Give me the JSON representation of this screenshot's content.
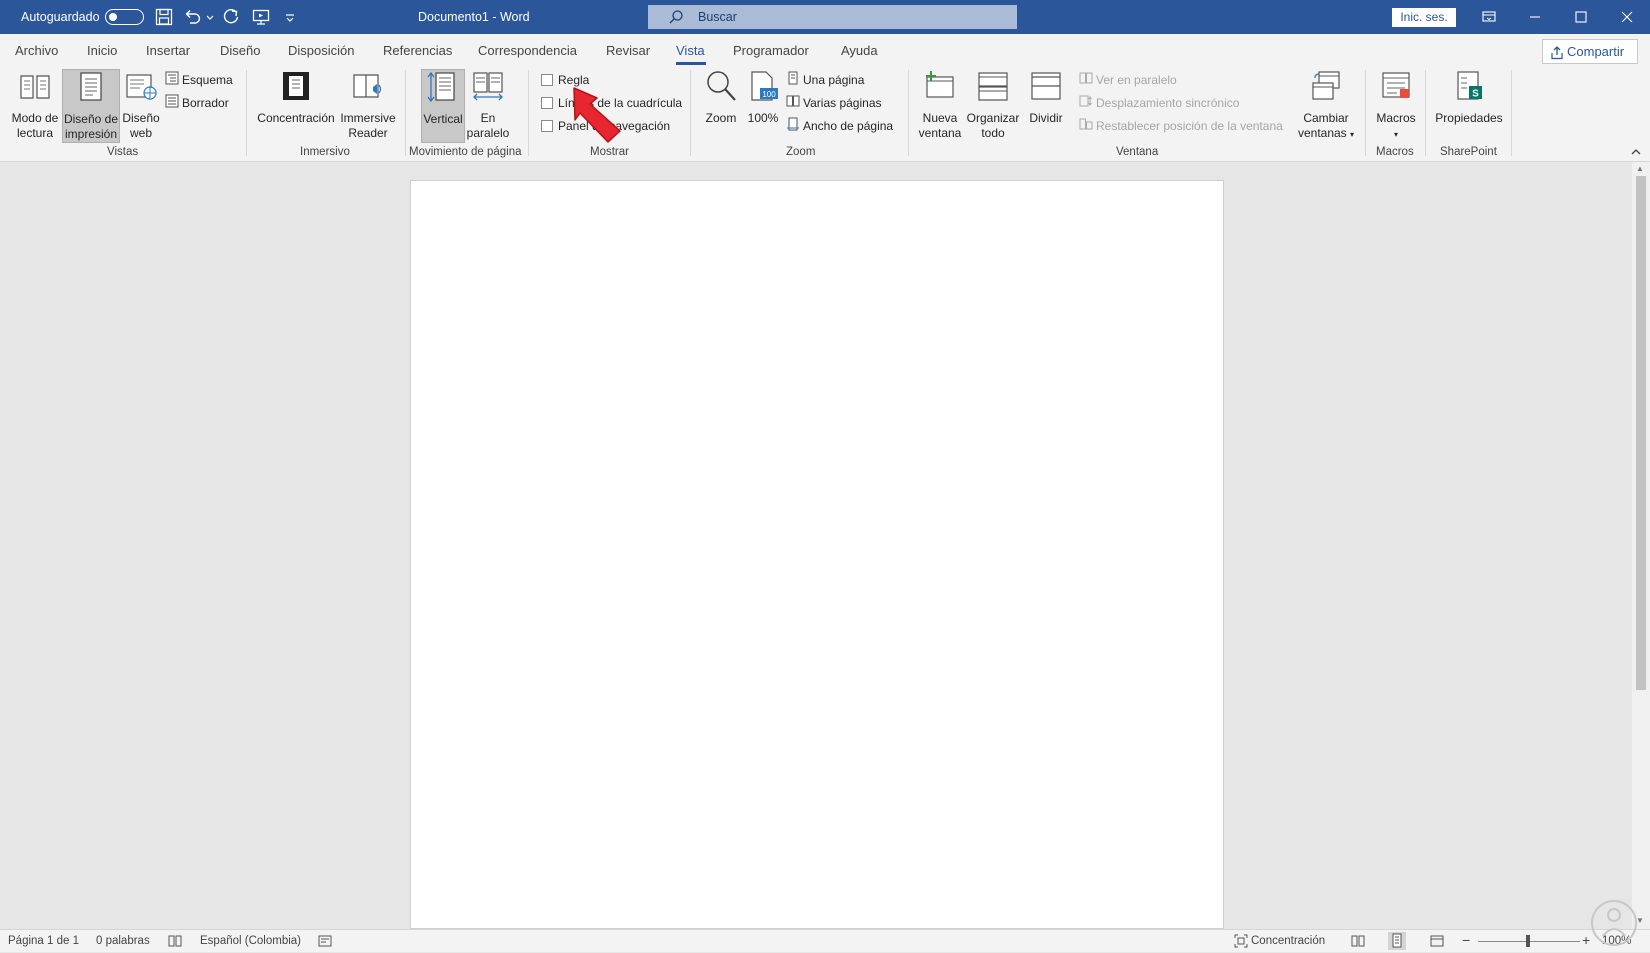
{
  "titlebar": {
    "autosave_label": "Autoguardado",
    "document_title": "Documento1 - Word",
    "search_placeholder": "Buscar",
    "signin_label": "Inic. ses."
  },
  "tabs": [
    "Archivo",
    "Inicio",
    "Insertar",
    "Diseño",
    "Disposición",
    "Referencias",
    "Correspondencia",
    "Revisar",
    "Vista",
    "Programador",
    "Ayuda"
  ],
  "active_tab": "Vista",
  "share_label": "Compartir",
  "ribbon": {
    "vistas": {
      "label": "Vistas",
      "modo_lectura": [
        "Modo de",
        "lectura"
      ],
      "diseno_impresion": [
        "Diseño de",
        "impresión"
      ],
      "diseno_web": [
        "Diseño",
        "web"
      ],
      "esquema": "Esquema",
      "borrador": "Borrador"
    },
    "inmersivo": {
      "label": "Inmersivo",
      "concentracion": "Concentración",
      "immersive_reader": [
        "Immersive",
        "Reader"
      ]
    },
    "movimiento": {
      "label": "Movimiento de página",
      "vertical": "Vertical",
      "en_paralelo": [
        "En",
        "paralelo"
      ]
    },
    "mostrar": {
      "label": "Mostrar",
      "regla": "Regla",
      "lineas": "Líneas de la cuadrícula",
      "panel": "Panel de navegación"
    },
    "zoom": {
      "label": "Zoom",
      "zoom": "Zoom",
      "pct": "100%",
      "una_pagina": "Una página",
      "varias_paginas": "Varias páginas",
      "ancho_pagina": "Ancho de página"
    },
    "ventana": {
      "label": "Ventana",
      "nueva": [
        "Nueva",
        "ventana"
      ],
      "organizar": [
        "Organizar",
        "todo"
      ],
      "dividir": "Dividir",
      "ver_paralelo": "Ver en paralelo",
      "desplazamiento": "Desplazamiento sincrónico",
      "restablecer": "Restablecer posición de la ventana",
      "cambiar": [
        "Cambiar",
        "ventanas"
      ]
    },
    "macros": {
      "label": "Macros",
      "macros": "Macros"
    },
    "sharepoint": {
      "label": "SharePoint",
      "propiedades": "Propiedades"
    }
  },
  "statusbar": {
    "page": "Página 1 de 1",
    "words": "0 palabras",
    "language": "Español (Colombia)",
    "focus": "Concentración",
    "zoom": "100%"
  },
  "colors": {
    "titlebar": "#2b579a",
    "arrow": "#e8262f"
  }
}
